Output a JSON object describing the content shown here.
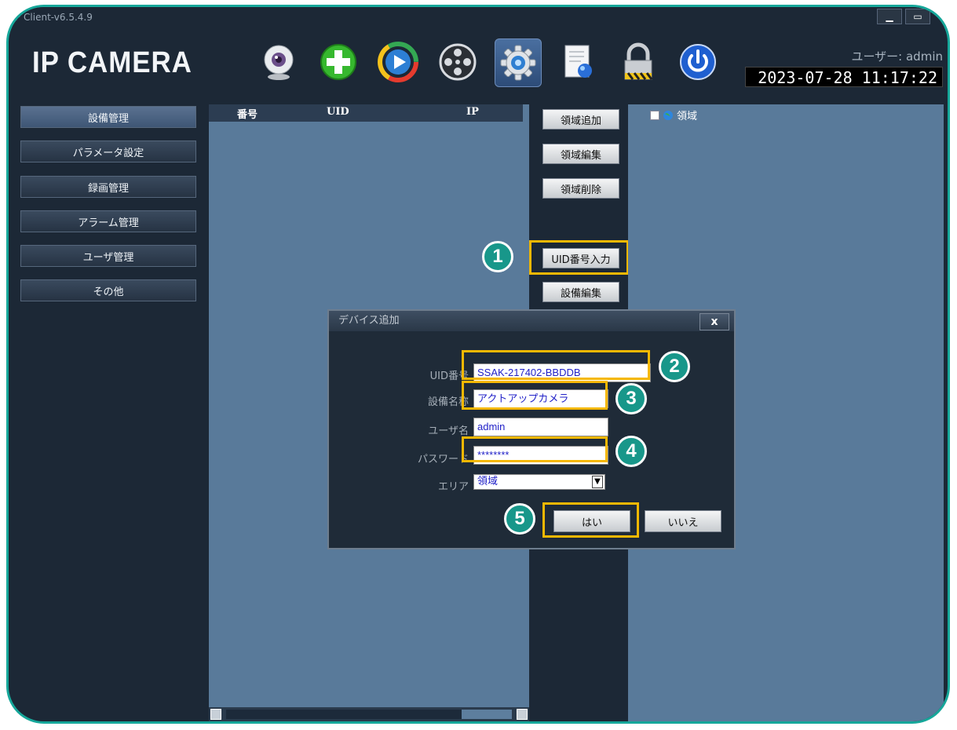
{
  "window": {
    "title": "P Client-v6.5.4.9",
    "controls": [
      "minimize-icon",
      "maximize-icon",
      "close-icon"
    ]
  },
  "header": {
    "logo": "IP CAMERA",
    "user_label": "ユーザー: admin",
    "datetime": "2023-07-28  11:17:22"
  },
  "toolbar": {
    "items": [
      {
        "icon": "webcam-icon",
        "active": false
      },
      {
        "icon": "add-icon",
        "active": false
      },
      {
        "icon": "play-icon",
        "active": false
      },
      {
        "icon": "film-reel-icon",
        "active": false
      },
      {
        "icon": "settings-gear-icon",
        "active": true
      },
      {
        "icon": "document-search-icon",
        "active": false
      },
      {
        "icon": "lock-icon",
        "active": false
      },
      {
        "icon": "power-icon",
        "active": false
      }
    ]
  },
  "sidebar": {
    "items": [
      {
        "label": "設備管理",
        "selected": true
      },
      {
        "label": "パラメータ設定",
        "selected": false
      },
      {
        "label": "録画管理",
        "selected": false
      },
      {
        "label": "アラーム管理",
        "selected": false
      },
      {
        "label": "ユーザ管理",
        "selected": false
      },
      {
        "label": "その他",
        "selected": false
      }
    ]
  },
  "device_list": {
    "columns": [
      "番号",
      "UID",
      "IP"
    ]
  },
  "middle_buttons": {
    "add_area": "領域追加",
    "edit_area": "領域編集",
    "delete_area": "領域削除",
    "uid_input": "UID番号入力",
    "edit_device": "設備編集"
  },
  "tree": {
    "root_label": "領域"
  },
  "dialog": {
    "title": "デバイス追加",
    "close": "x",
    "fields": {
      "uid": {
        "label": "UID番号",
        "value": "SSAK-217402-BBDDB"
      },
      "name": {
        "label": "設備名称",
        "value": "アクトアップカメラ"
      },
      "user": {
        "label": "ユーザ名",
        "value": "admin"
      },
      "password": {
        "label": "パスワード",
        "value": "********"
      },
      "area": {
        "label": "エリア",
        "value": "領域"
      }
    },
    "ok": "はい",
    "cancel": "いいえ"
  },
  "annotations": {
    "badges": [
      "1",
      "2",
      "3",
      "4",
      "5"
    ],
    "highlight_color": "#f5b800",
    "badge_color": "#18978a"
  },
  "colors": {
    "frame_border": "#16a79a",
    "app_background": "#1c2836",
    "panel": "#597a9a"
  }
}
